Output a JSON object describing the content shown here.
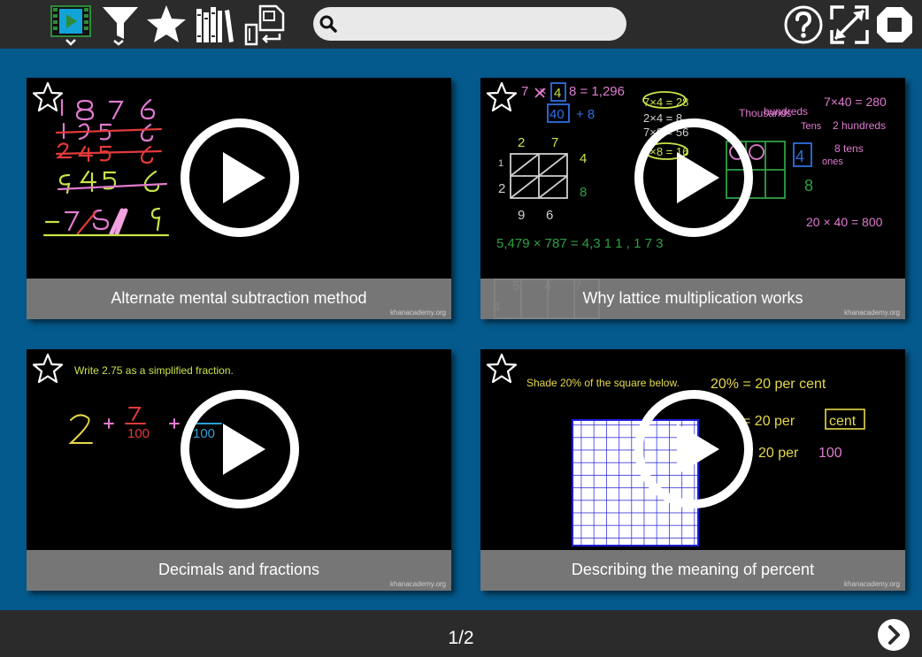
{
  "toolbar": {
    "icons": [
      "video-library-icon",
      "filter-icon",
      "favorites-star-icon",
      "library-books-icon",
      "file-transfer-icon"
    ],
    "search": {
      "placeholder": "",
      "value": ""
    },
    "right_icons": [
      "help-icon",
      "fullscreen-icon",
      "stop-icon"
    ]
  },
  "videos": [
    {
      "title": "Alternate mental subtraction method",
      "watermark": "khanacademy.org"
    },
    {
      "title": "Why lattice multiplication works",
      "watermark": "khanacademy.org"
    },
    {
      "title": "Decimals and fractions",
      "watermark": "khanacademy.org",
      "prompt": "Write 2.75 as a simplified fraction."
    },
    {
      "title": "Describing the meaning of percent",
      "watermark": "khanacademy.org",
      "prompt": "Shade 20% of the square below."
    }
  ],
  "pagination": {
    "label": "1/2"
  },
  "colors": {
    "topbar": "#2b2b2b",
    "background": "#045a8d",
    "caption": "#808080"
  }
}
